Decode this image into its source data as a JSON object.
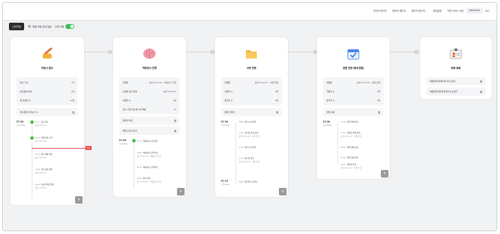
{
  "topnav": {
    "items": [
      "관리자 페이지",
      "협력사 페이지",
      "평가자 페이지 ⌄",
      "환경설정",
      "지원 서비스 안내",
      "admin-kim",
      "로그"
    ],
    "active_index": 5
  },
  "toolbar": {
    "process_button": "나의작업",
    "settings_link": "채용 자동 운영 설정",
    "toggle_label": "단계 자동",
    "toggle_on": true
  },
  "colors": {
    "accent_green": "#34c059",
    "alert_red": "#e74b4b",
    "tag_blue": "#2a6bd6"
  },
  "cards": [
    {
      "icon": "writing-hand-icon",
      "title": "지원서 접수",
      "rows": [
        [
          "접수 기간",
          "1개"
        ],
        [
          "제출완료 대비",
          "5개"
        ],
        [
          "총 지원자 수",
          "12명"
        ]
      ],
      "sub": "제출완료자 미보기 0",
      "date": "07.09",
      "date_sub": "오전 09:00",
      "events": [
        {
          "time": "11:37",
          "text": "공고 게시",
          "sub": "승인 7/9 11:37"
        },
        {
          "time": "12:00",
          "text": "지원 마감 시작",
          "sub": "승인 7/9 11:37"
        },
        {
          "time": "12:10",
          "text": "접수 제외 명단",
          "sub": "승인 7/9 11:37"
        },
        {
          "time": "14:00",
          "text": "자료 정보 확인",
          "sub": "승인 7/9 11:37"
        },
        {
          "time": "16:00",
          "text": "자료의 재출 확인",
          "sub": "승인 7/9 11:37"
        }
      ],
      "red_label": "현재"
    },
    {
      "icon": "brain-icon",
      "title": "역량검사 진행",
      "rows": [
        [
          "진행일",
          "승급 7/9 11:37 ~ 역량검사 진행"
        ],
        [
          "관계된 검사 일정",
          "승급 7/9 11:37"
        ],
        [
          "지원자 수",
          "3명"
        ],
        [
          "검사 시행 가능 응시자 배분",
          "12"
        ]
      ],
      "sub1": "대상자 확인",
      "sub2": "역량 소개서 보기",
      "date": "07.09",
      "date_sub": "오전 09:00",
      "events": [
        {
          "time": "12:10",
          "text": "역량검사 시작 준비",
          "sub": ""
        },
        {
          "time": "13:00",
          "text": "역량검사 진행 안내",
          "sub": "승급 7/9 11:37 · 역량검사 진행"
        },
        {
          "time": "15:00",
          "text": "역량검사 진행 확인",
          "sub": ""
        },
        {
          "time": "18:00",
          "text": "평가 마감",
          "sub": "승급 7/9 11:37 · 역량검사 진행"
        }
      ]
    },
    {
      "icon": "folder-icon",
      "title": "서류 전형",
      "rows": [
        [
          "전형일",
          "승급 7/9 11:37 ~ 서류 전형"
        ],
        [
          "지원자 수",
          "3명"
        ],
        [
          "평가자 수",
          "3명"
        ]
      ],
      "sub": "평균조 확인",
      "date": "07.09",
      "date_sub": "오전 09:00",
      "date2": "07.10",
      "date2_sub": "오전 09:00",
      "events": [
        {
          "time": "09:00",
          "text": "평가 시작 준비",
          "sub": ""
        },
        {
          "time": "10:00",
          "text": "평가자 전형 안내",
          "sub": "승급 7/9 11:37 · 서류 전형"
        },
        {
          "time": "17:10",
          "text": "평가 시작 접수",
          "sub": ""
        },
        {
          "time": "17:10",
          "text": "평가의 접수",
          "sub": "승급 7/9 11:37 · 서류 전형"
        },
        {
          "time": "09:00",
          "text": "평가서 스크리닝",
          "sub": ""
        }
      ]
    },
    {
      "icon": "calendar-check-icon",
      "title": "면접 전형 (화상면접)",
      "rows": [
        [
          "면접일",
          "승급 7/9 11:37 ~ 면접 전형"
        ],
        [
          "지원자 수",
          "3명"
        ],
        [
          "평가자 수",
          "3명"
        ]
      ],
      "sub": "면접 허용",
      "date": "07.09",
      "date_sub": "오전 09:00",
      "events": [
        {
          "time": "17:00",
          "text": "면접 현황 체크",
          "sub": ""
        },
        {
          "time": "17:17",
          "text": "지원자 면접 안내",
          "sub": "승급 7/9 11:37 · 면접 전형"
        },
        {
          "time": "08:00",
          "text": "면접 현황 정보",
          "sub": ""
        },
        {
          "time": "10:00",
          "text": "면접 현황 확인",
          "sub": ""
        },
        {
          "time": "14:00",
          "text": "면접의 결과",
          "sub": "승급 7/9 11:37 · 면접 전형"
        }
      ]
    },
    {
      "icon": "id-card-icon",
      "title": "채용 종료",
      "sub1": "채용합격자에게 메시지 보내기",
      "sub2": "채용불합격자에게 메시지 보내기"
    }
  ]
}
